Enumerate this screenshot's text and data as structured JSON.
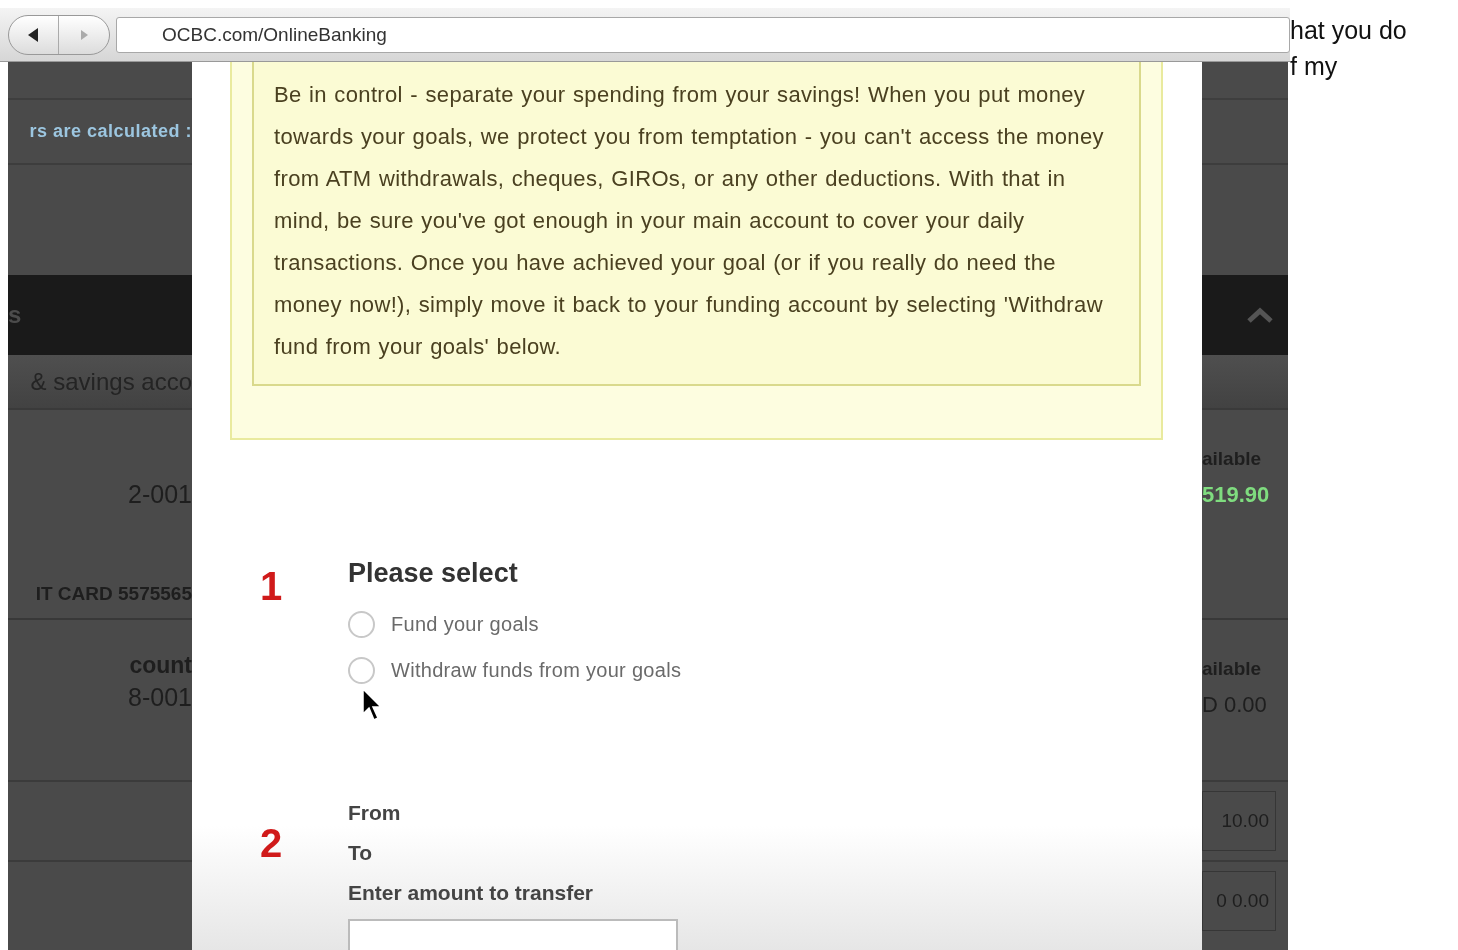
{
  "browser": {
    "back_enabled": true,
    "forward_enabled": false,
    "address": "OCBC.com/OnlineBanking"
  },
  "caption_lines": [
    "hat you do",
    "f my"
  ],
  "background_rows": [
    {
      "kind": "band"
    },
    {
      "kind": "link",
      "left": "rs are calculated :"
    },
    {
      "kind": "spacer"
    },
    {
      "kind": "header",
      "left": "s"
    },
    {
      "kind": "subheader",
      "left": "& savings acco"
    },
    {
      "kind": "account",
      "left_number": "2-001",
      "right_label": "ailable",
      "right_value": "519.90",
      "value_positive": true
    },
    {
      "kind": "card",
      "left": "IT CARD 5575565"
    },
    {
      "kind": "account",
      "left_name": "count",
      "left_number": "8-001",
      "right_label": "ailable",
      "right_value": "D 0.00",
      "value_positive": false
    },
    {
      "kind": "amount",
      "right_value": "10.00"
    },
    {
      "kind": "amount",
      "right_value": "0 0.00"
    }
  ],
  "dialog": {
    "notice": "Be in control - separate your spending from your savings! When you put money towards your goals, we protect you from temptation - you can't access the money from ATM withdrawals, cheques, GIROs, or any other deductions. With that in mind, be sure you've got enough in your main account to cover your daily transactions. Once you have achieved your goal (or if you really do need the money now!), simply move it back to your funding account by selecting 'Withdraw fund from your goals' below.",
    "step1": {
      "number": "1",
      "title": "Please select",
      "options": [
        {
          "label": "Fund your goals",
          "selected": false
        },
        {
          "label": "Withdraw funds from your goals",
          "selected": false
        }
      ]
    },
    "step2": {
      "number": "2",
      "labels": [
        "From",
        "To",
        "Enter amount to transfer"
      ]
    }
  }
}
